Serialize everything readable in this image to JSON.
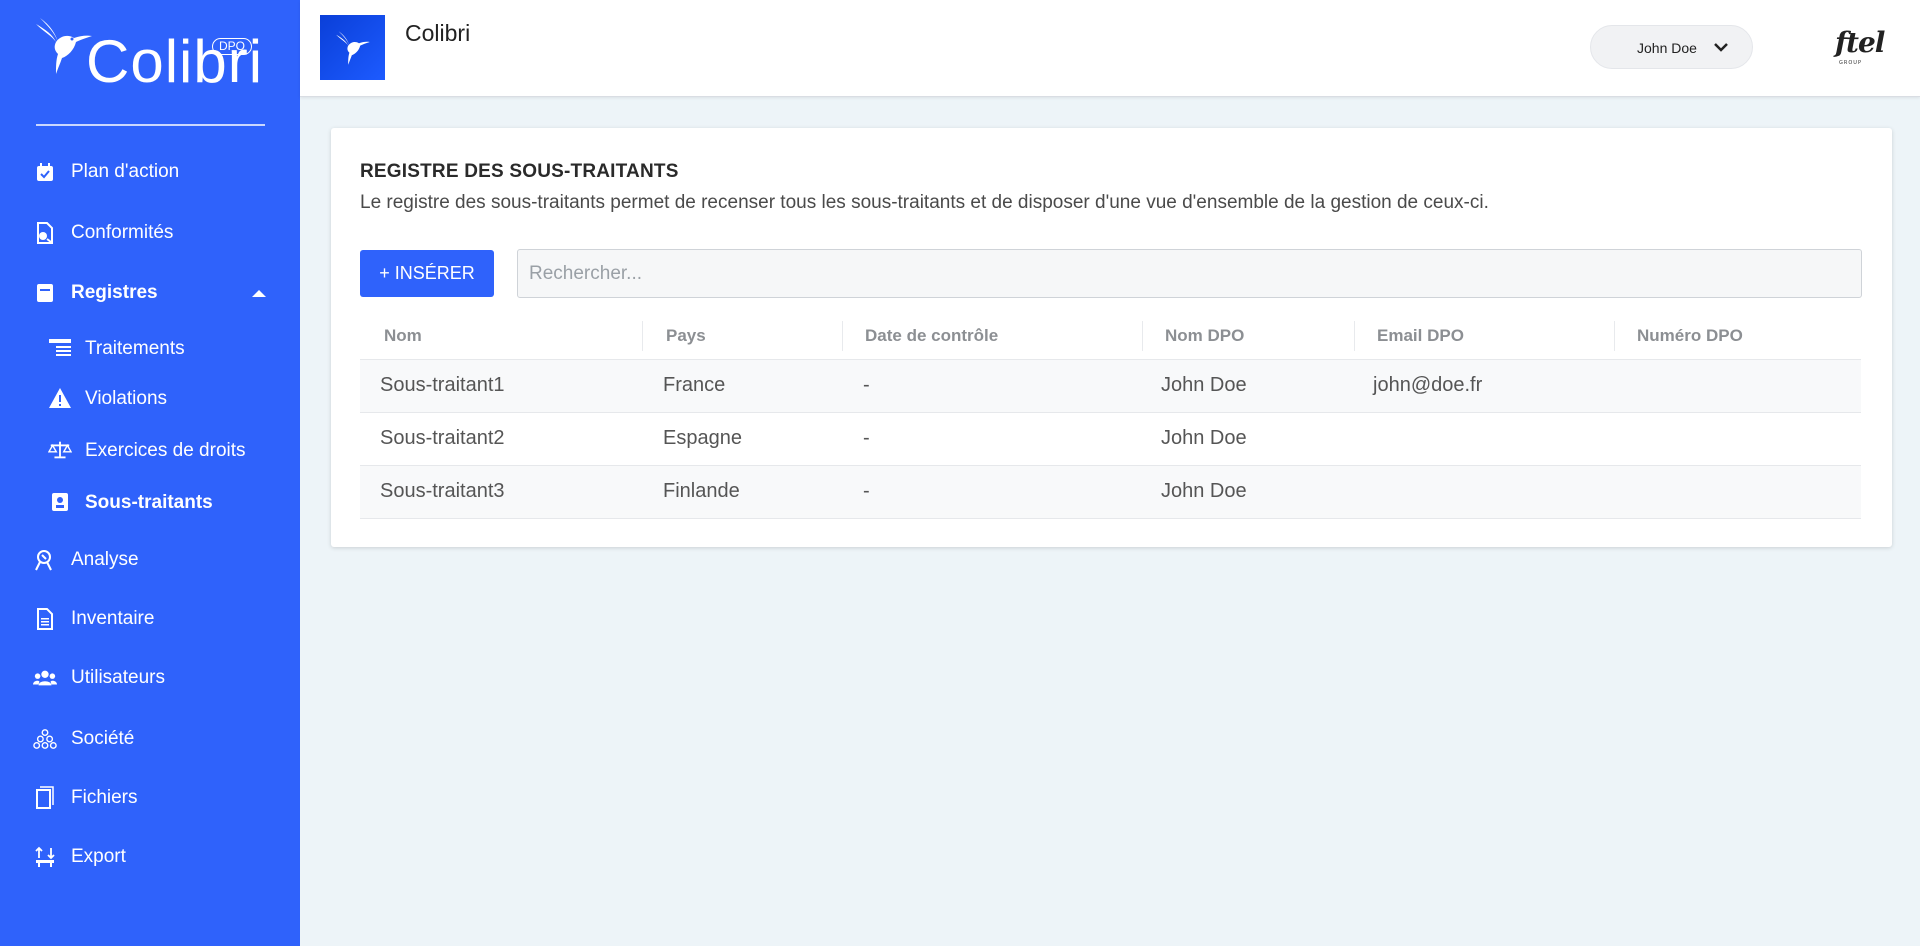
{
  "brand": {
    "word": "Colibri",
    "badge": "DPO"
  },
  "sidebar": {
    "items": [
      {
        "label": "Plan d'action",
        "icon": "calendar-check-icon"
      },
      {
        "label": "Conformités",
        "icon": "document-check-icon"
      },
      {
        "label": "Registres",
        "icon": "book-icon",
        "expanded": true
      },
      {
        "label": "Analyse",
        "icon": "analysis-icon"
      },
      {
        "label": "Inventaire",
        "icon": "file-lines-icon"
      },
      {
        "label": "Utilisateurs",
        "icon": "users-icon"
      },
      {
        "label": "Société",
        "icon": "company-icon"
      },
      {
        "label": "Fichiers",
        "icon": "files-icon"
      },
      {
        "label": "Export",
        "icon": "export-icon"
      }
    ],
    "sub_items": [
      {
        "label": "Traitements",
        "icon": "table-list-icon"
      },
      {
        "label": "Violations",
        "icon": "warning-icon"
      },
      {
        "label": "Exercices de droits",
        "icon": "scale-icon"
      },
      {
        "label": "Sous-traitants",
        "icon": "contact-card-icon",
        "active": true
      }
    ]
  },
  "header": {
    "title": "Colibri",
    "user": "John Doe",
    "partner_logo": "ftel",
    "partner_tagline": "GROUP"
  },
  "card": {
    "title": "REGISTRE DES SOUS-TRAITANTS",
    "description": "Le registre des sous-traitants permet de recenser tous les sous-traitants et de disposer d'une vue d'ensemble de la gestion de ceux-ci.",
    "insert_label": "+ INSÉRER",
    "search_placeholder": "Rechercher..."
  },
  "table": {
    "columns": [
      "Nom",
      "Pays",
      "Date de contrôle",
      "Nom DPO",
      "Email DPO",
      "Numéro DPO"
    ],
    "rows": [
      [
        "Sous-traitant1",
        "France",
        "-",
        "John Doe",
        "john@doe.fr",
        ""
      ],
      [
        "Sous-traitant2",
        "Espagne",
        "-",
        "John Doe",
        "",
        ""
      ],
      [
        "Sous-traitant3",
        "Finlande",
        "-",
        "John Doe",
        "",
        ""
      ]
    ]
  },
  "colors": {
    "accent": "#2f62fb",
    "background": "#edf4f8"
  }
}
